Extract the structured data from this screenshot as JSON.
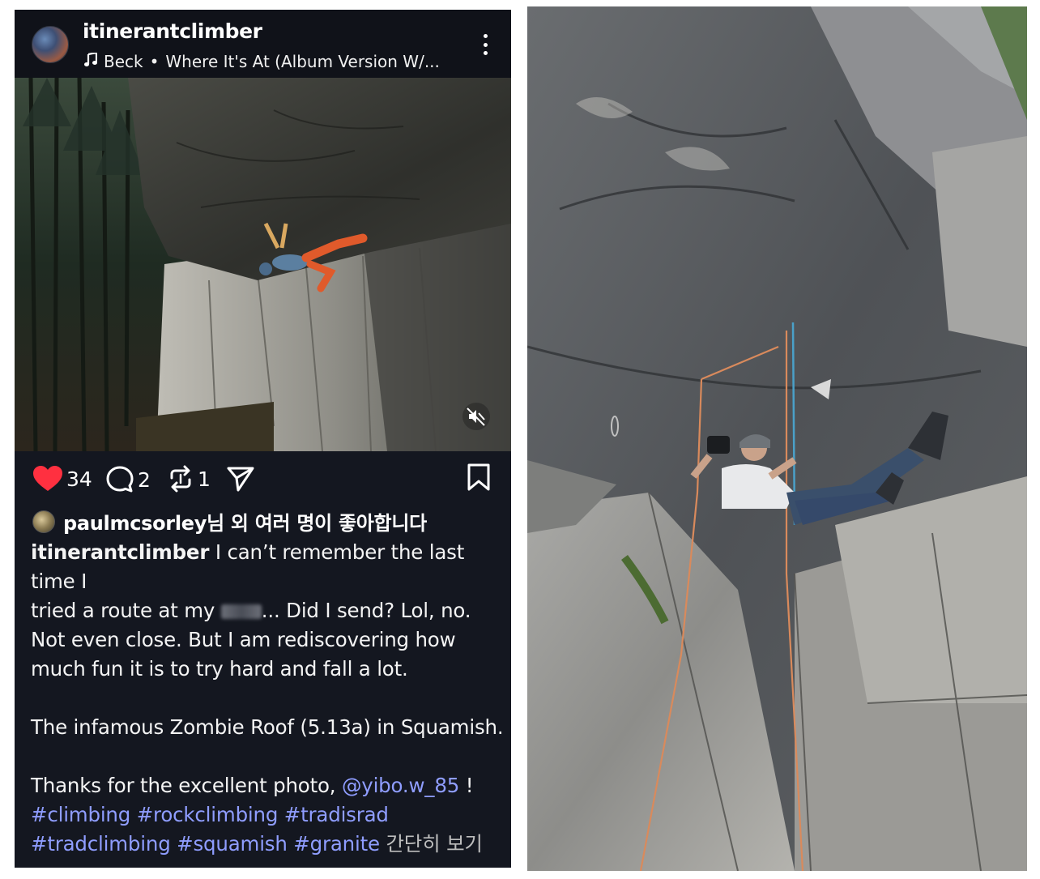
{
  "post": {
    "username": "itinerantclimber",
    "music": {
      "icon": "music-note-icon",
      "artist": "Beck",
      "separator": "•",
      "track": "Where It's At (Album Version W/..."
    },
    "counts": {
      "likes": "34",
      "comments": "2",
      "reposts": "1"
    },
    "liked_by": {
      "user": "paulmcsorley",
      "suffix": "님 외 여러 명이 좋아합니다"
    },
    "caption": {
      "author": "itinerantclimber",
      "line1": "I can’t remember the last time I",
      "line2_a": "tried a route at my",
      "line2_b": "... Did I send? Lol, no.",
      "line3": "Not even close. But I am rediscovering how",
      "line4": "much fun it is to try hard and fall a lot.",
      "line5": "The infamous Zombie Roof (5.13a) in Squamish.",
      "line6_a": "Thanks for the excellent photo,",
      "mention": "@yibo.w_85",
      "line6_b": " !",
      "hashtags_line1": "#climbing #rockclimbing #tradisrad",
      "hashtags_line2": "#tradclimbing #squamish #granite",
      "more": "간단히 보기"
    },
    "colors": {
      "background": "#141720",
      "heart": "#ff3040",
      "link": "#8f9dff"
    }
  }
}
